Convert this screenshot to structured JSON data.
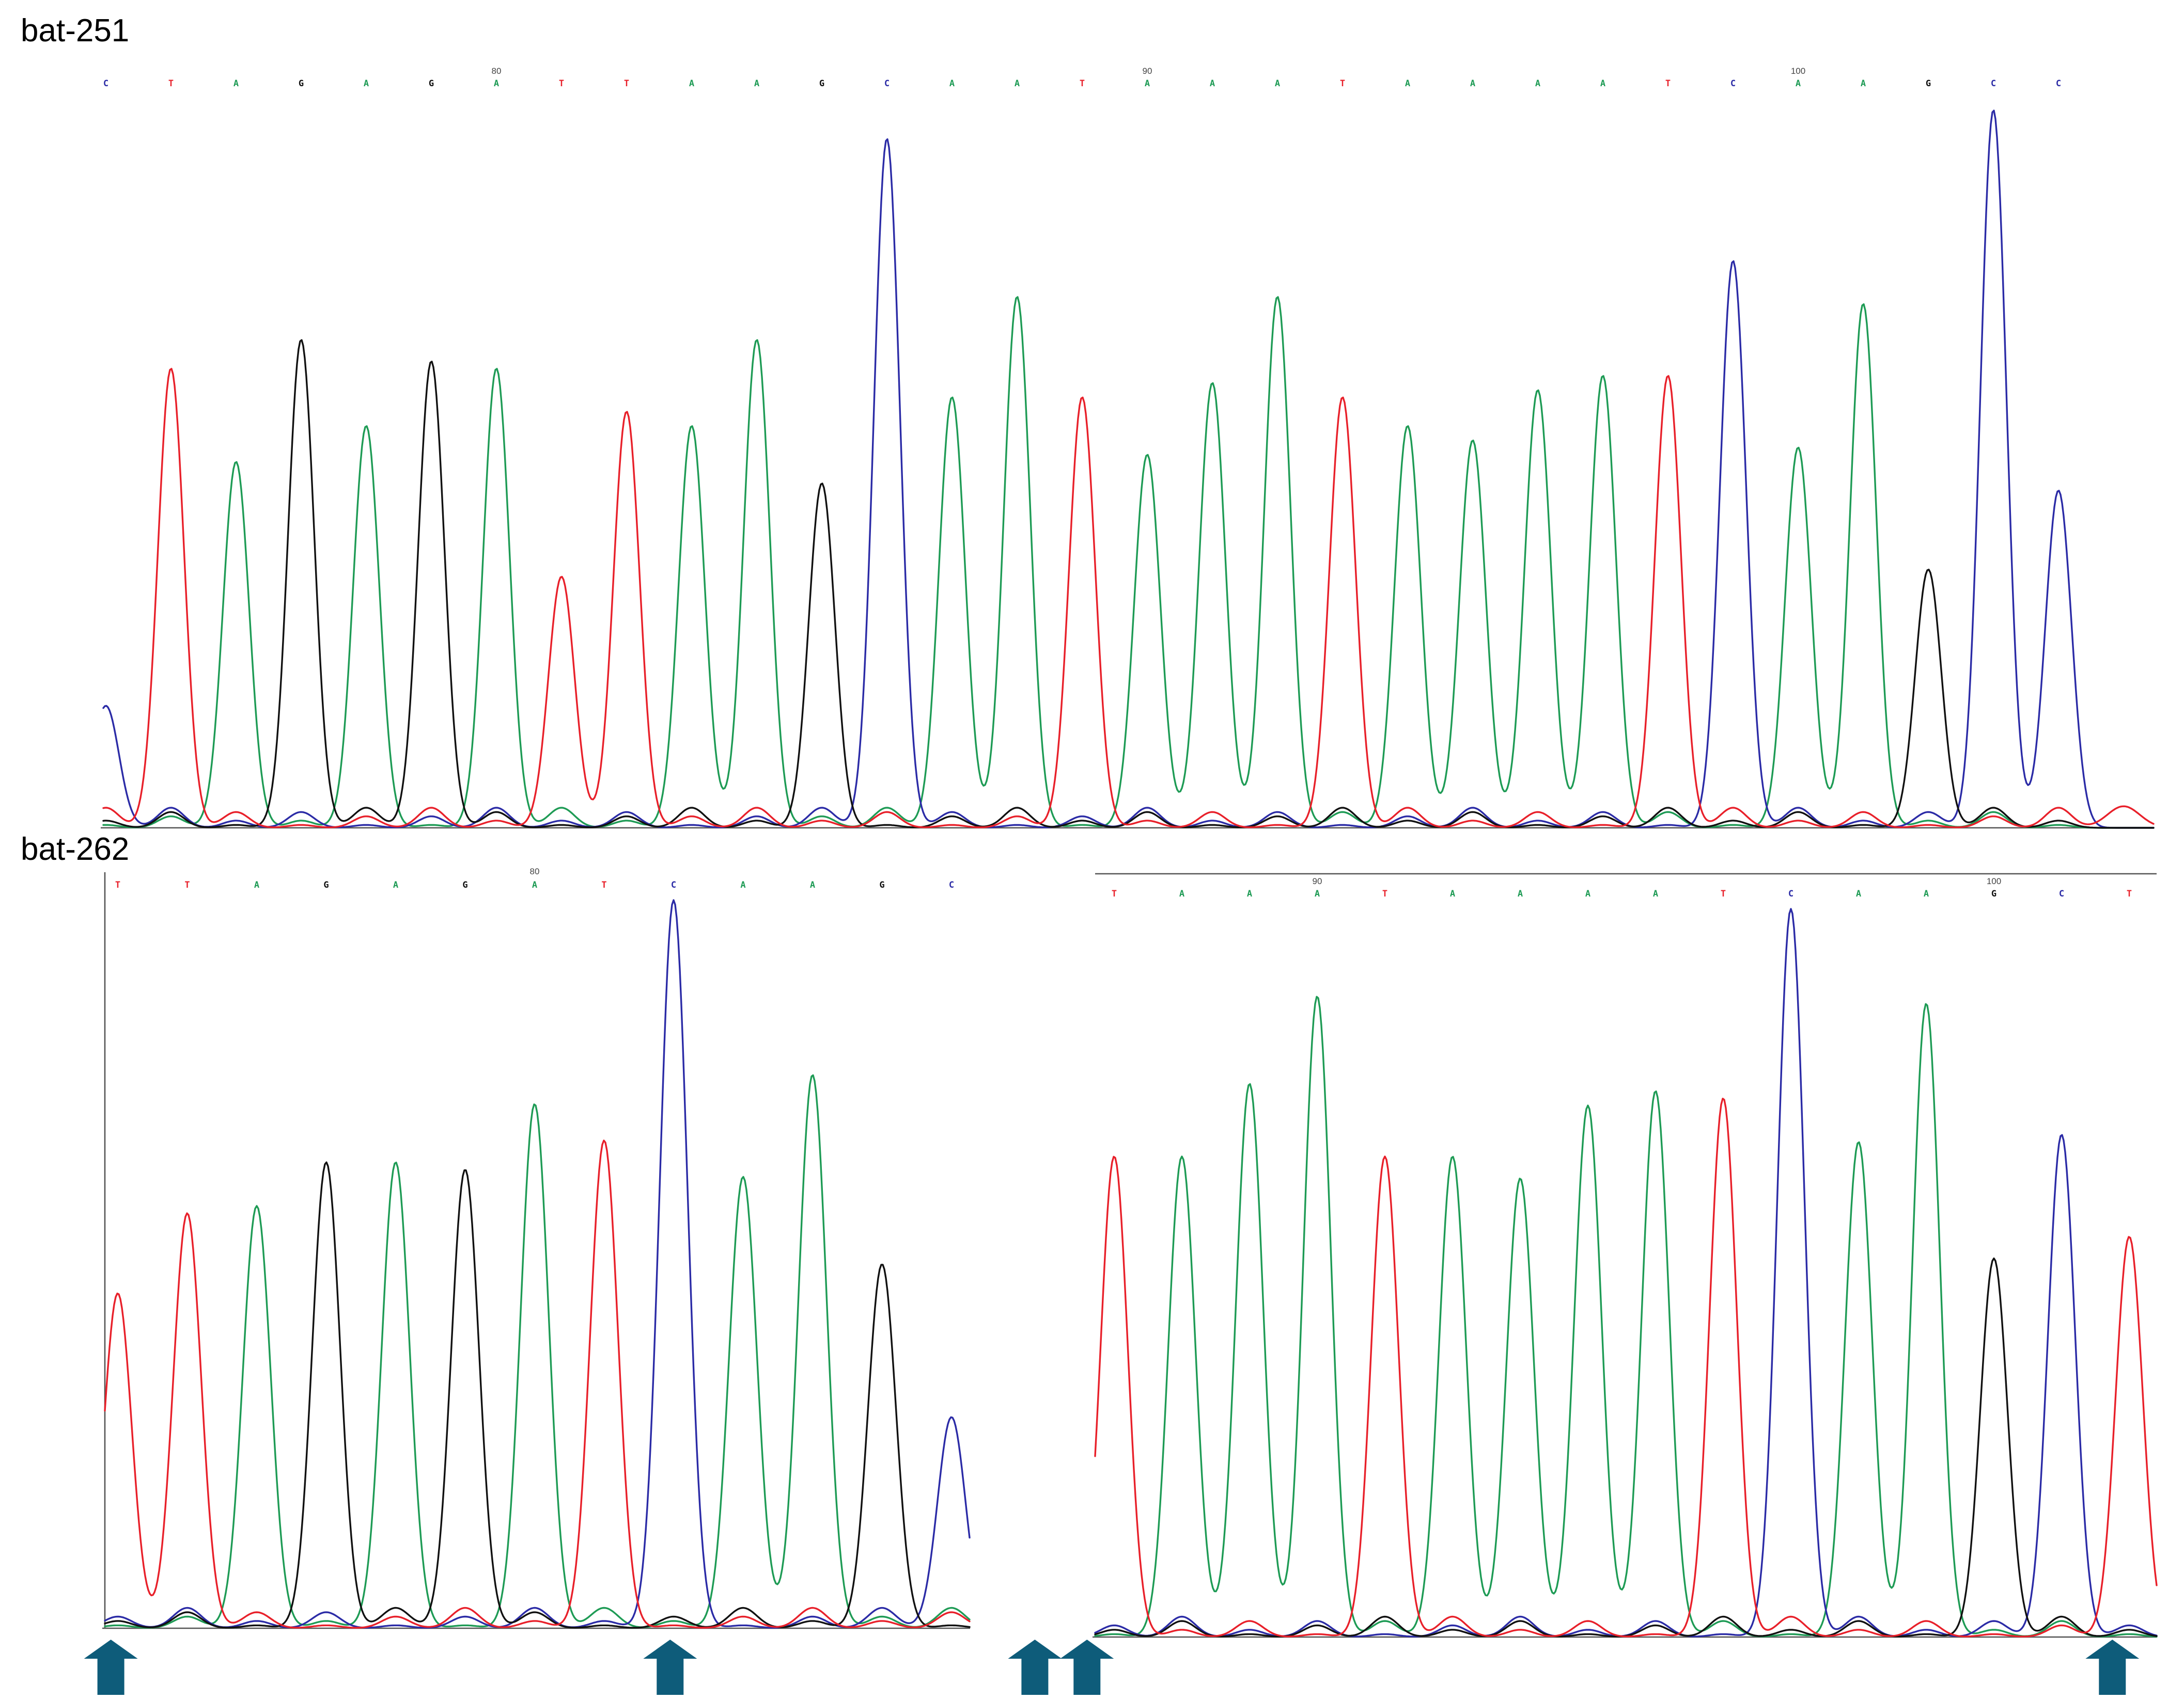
{
  "colors": {
    "A": "#1e9b55",
    "C": "#2b2ba6",
    "G": "#111111",
    "T": "#e8202a",
    "arrow": "#0e5c7a"
  },
  "chart_data": [
    {
      "type": "line",
      "label": "bat-251",
      "bases": [
        "C",
        "T",
        "A",
        "G",
        "A",
        "G",
        "A",
        "T",
        "T",
        "A",
        "A",
        "G",
        "C",
        "A",
        "A",
        "T",
        "A",
        "A",
        "A",
        "T",
        "A",
        "A",
        "A",
        "A",
        "T",
        "C",
        "A",
        "A",
        "G",
        "C",
        "C"
      ],
      "peaks": [
        0.17,
        0.64,
        0.51,
        0.68,
        0.56,
        0.65,
        0.64,
        0.35,
        0.58,
        0.56,
        0.68,
        0.48,
        0.96,
        0.6,
        0.74,
        0.6,
        0.52,
        0.62,
        0.74,
        0.6,
        0.56,
        0.54,
        0.61,
        0.63,
        0.63,
        0.79,
        0.53,
        0.73,
        0.36,
        1.0,
        0.47
      ],
      "position_labels": [
        {
          "base_index": 6,
          "text": "80"
        },
        {
          "base_index": 16,
          "text": "90"
        },
        {
          "base_index": 26,
          "text": "100"
        }
      ]
    },
    {
      "type": "line",
      "label": "bat-262",
      "bases": [
        "T",
        "T",
        "A",
        "G",
        "A",
        "G",
        "A",
        "T",
        "C",
        "A",
        "A",
        "G",
        "C"
      ],
      "peaks": [
        0.46,
        0.57,
        0.58,
        0.64,
        0.64,
        0.63,
        0.72,
        0.67,
        1.0,
        0.62,
        0.76,
        0.5,
        0.29
      ],
      "position_labels": [
        {
          "base_index": 6,
          "text": "80"
        }
      ]
    },
    {
      "type": "line",
      "label": "",
      "bases": [
        "T",
        "A",
        "A",
        "A",
        "T",
        "A",
        "A",
        "A",
        "A",
        "T",
        "C",
        "A",
        "A",
        "G",
        "C",
        "T"
      ],
      "peaks": [
        0.66,
        0.66,
        0.76,
        0.88,
        0.66,
        0.66,
        0.63,
        0.73,
        0.75,
        0.74,
        1.0,
        0.68,
        0.87,
        0.52,
        0.69,
        0.55
      ],
      "position_labels": [
        {
          "base_index": 3,
          "text": "90"
        },
        {
          "base_index": 13,
          "text": "100"
        }
      ]
    }
  ],
  "arrows": [
    {
      "panel": 1,
      "base_position": -0.1
    },
    {
      "panel": 1,
      "base_position": 7.95
    },
    {
      "panel": 1,
      "base_position": 13.2
    },
    {
      "panel": 1,
      "base_position": 13.95
    },
    {
      "panel": 2,
      "base_position": 14.75
    }
  ]
}
